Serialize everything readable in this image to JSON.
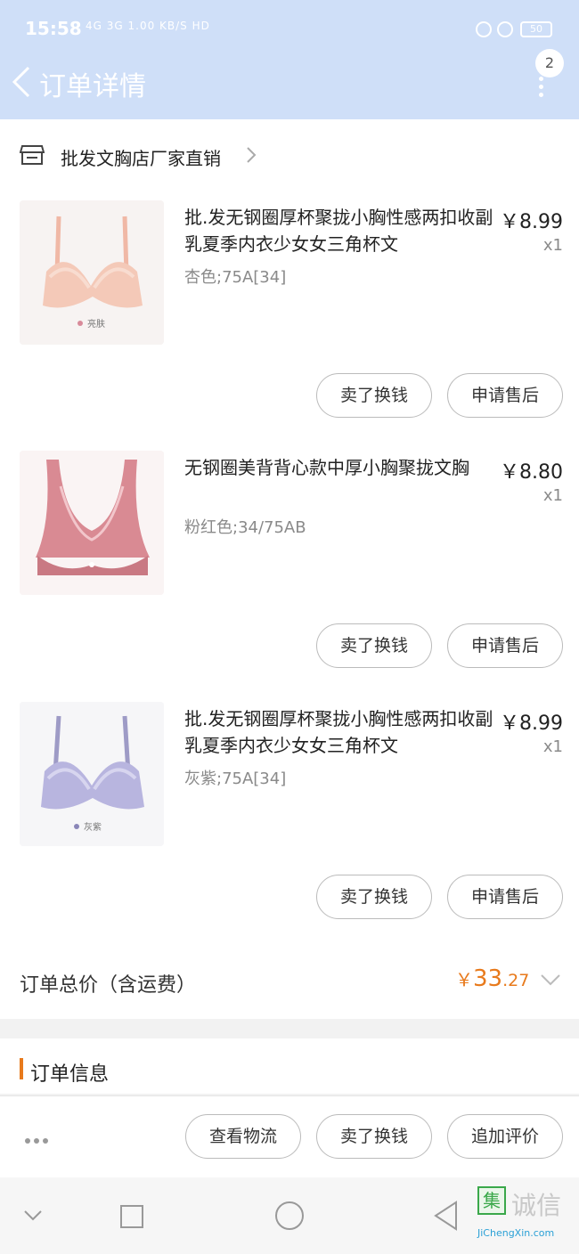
{
  "status_bar": {
    "time": "15:58",
    "network": "4G 3G 1.00 KB/S HD",
    "battery": "50"
  },
  "header": {
    "title": "订单详情",
    "badge_count": "2"
  },
  "shop": {
    "name": "批发文胸店厂家直销"
  },
  "items": [
    {
      "name": "批.发无钢圈厚杯聚拢小胸性感两扣收副乳夏季内衣少女女三角杯文",
      "sku": "杏色;75A[34]",
      "price": "￥8.99",
      "qty": "x1",
      "thumb_label": "亮肤",
      "buttons": [
        "卖了换钱",
        "申请售后"
      ]
    },
    {
      "name": "无钢圈美背背心款中厚小胸聚拢文胸",
      "sku": "粉红色;34/75AB",
      "price": "￥8.80",
      "qty": "x1",
      "thumb_label": "",
      "buttons": [
        "卖了换钱",
        "申请售后"
      ]
    },
    {
      "name": "批.发无钢圈厚杯聚拢小胸性感两扣收副乳夏季内衣少女女三角杯文",
      "sku": "灰紫;75A[34]",
      "price": "￥8.99",
      "qty": "x1",
      "thumb_label": "灰紫",
      "buttons": [
        "卖了换钱",
        "申请售后"
      ]
    }
  ],
  "total": {
    "label": "订单总价（含运费）",
    "currency": "￥",
    "integer": "33",
    "decimal": ".27"
  },
  "order_info": {
    "title": "订单信息"
  },
  "action_bar": {
    "buttons": [
      "查看物流",
      "卖了换钱",
      "追加评价"
    ]
  },
  "watermark": {
    "mark": "集",
    "text": "诚信",
    "url": "JiChengXin.com"
  },
  "colors": {
    "header_bg": "#cfdff8",
    "accent": "#e87a1c",
    "watermark_green": "#3aa84a"
  }
}
